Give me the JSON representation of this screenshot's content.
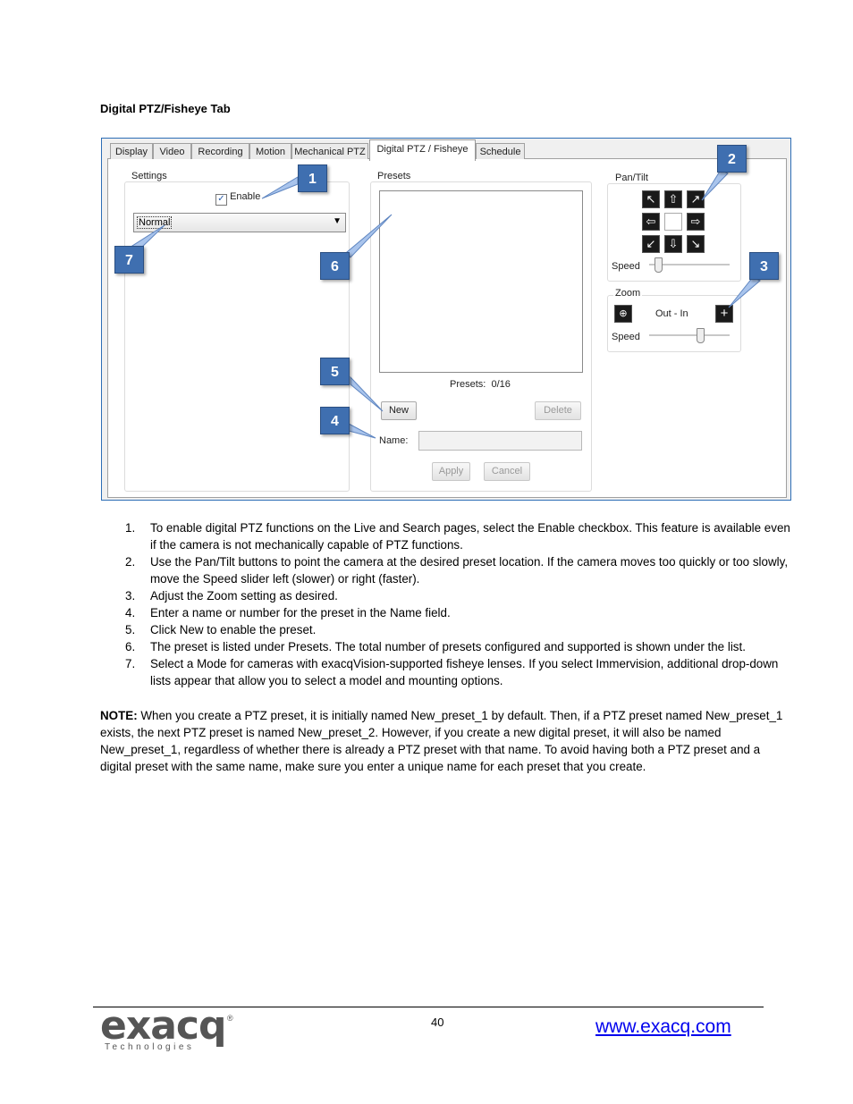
{
  "heading": "Digital PTZ/Fisheye Tab",
  "screenshot": {
    "tabs": [
      "Display",
      "Video",
      "Recording",
      "Motion",
      "Mechanical PTZ",
      "Digital PTZ / Fisheye",
      "Schedule"
    ],
    "active_tab": "Digital PTZ / Fisheye",
    "settings": {
      "label": "Settings",
      "enable_label": "Enable",
      "enable_checked": true,
      "mode_value": "Normal"
    },
    "presets": {
      "label": "Presets",
      "count_text": "Presets:  0/16",
      "new_label": "New",
      "delete_label": "Delete",
      "name_label": "Name:",
      "name_value": "",
      "apply_label": "Apply",
      "cancel_label": "Cancel"
    },
    "pan_tilt": {
      "label": "Pan/Tilt",
      "speed_label": "Speed",
      "speed_value_fraction": 0.1
    },
    "zoom": {
      "label": "Zoom",
      "out_in_label": "Out - In",
      "speed_label": "Speed",
      "speed_value_fraction": 0.6
    },
    "callouts": [
      "1",
      "2",
      "3",
      "4",
      "5",
      "6",
      "7"
    ],
    "colors": {
      "callout": "#3f6fb0",
      "frame": "#2d6db5"
    }
  },
  "steps": [
    {
      "num": "1.",
      "text": "To enable digital PTZ functions on the Live and Search pages, select the Enable checkbox. This feature is available even if the camera is not mechanically capable of PTZ functions."
    },
    {
      "num": "2.",
      "text": "Use the Pan/Tilt buttons to point the camera at the desired preset location. If the camera moves too quickly or too slowly, move the Speed slider left (slower) or right (faster)."
    },
    {
      "num": "3.",
      "text": "Adjust the Zoom setting as desired."
    },
    {
      "num": "4.",
      "text": "Enter a name or number for the preset in the Name field."
    },
    {
      "num": "5.",
      "text": "Click New to enable the preset."
    },
    {
      "num": "6.",
      "text": "The preset is listed under Presets. The total number of presets configured and supported is shown under the list."
    },
    {
      "num": "7.",
      "text": "Select a Mode for cameras with exacqVision-supported fisheye lenses. If you select Immervision, additional drop-down lists appear that allow you to select a model and mounting options."
    }
  ],
  "note": {
    "label": "NOTE:",
    "text": " When you create a PTZ preset, it is initially named New_preset_1 by default. Then, if a PTZ preset named New_preset_1 exists, the next PTZ preset is named New_preset_2. However, if you create a new digital preset, it will also be named New_preset_1, regardless of whether there is already a PTZ preset with that name. To avoid having both a PTZ preset and a digital preset with the same name, make sure you enter a unique name for each preset that you create."
  },
  "footer": {
    "page_number": "40",
    "website": "www.exacq.com",
    "logo_word": "exacq",
    "logo_sub": "Technologies",
    "logo_reg": "®"
  }
}
